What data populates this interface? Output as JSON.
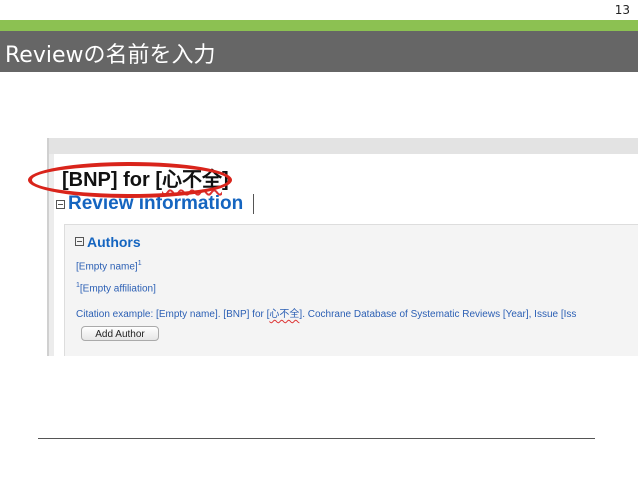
{
  "slide": {
    "page_number": "13",
    "title": "Reviewの名前を入力"
  },
  "review": {
    "title_prefix": "[BNP] for [",
    "title_jp": "心不全",
    "title_suffix": "]",
    "section_title": "Review information",
    "authors_title": "Authors",
    "author_name": "[Empty name]",
    "author_sup": "1",
    "affiliation_sup": "1",
    "affiliation": "[Empty affiliation]",
    "citation_prefix": "Citation example: [Empty name]. [BNP] for [",
    "citation_jp": "心不全",
    "citation_suffix": "]. Cochrane Database of Systematic Reviews [Year], Issue [Iss",
    "add_author_label": "Add Author"
  },
  "colors": {
    "accent_green": "#8cc152",
    "title_bar": "#666666",
    "link_blue": "#1565c0",
    "highlight_red": "#d9241b"
  }
}
